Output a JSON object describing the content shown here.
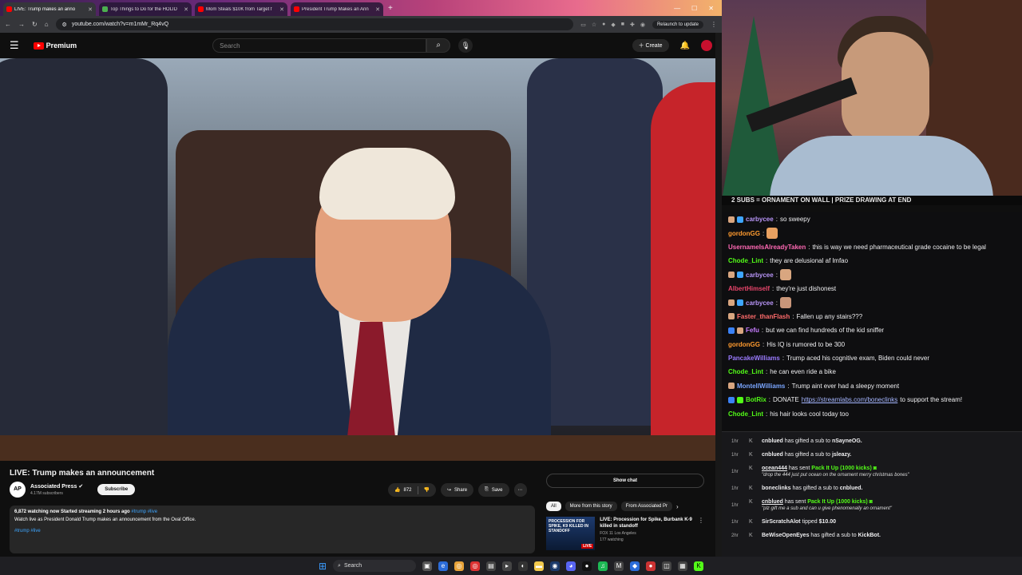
{
  "browser": {
    "tabs": [
      {
        "title": "LIVE: Trump makes an anno",
        "active": true
      },
      {
        "title": "Top Things to Do for the HOLID",
        "active": false
      },
      {
        "title": "Mom Steals $10K from Target f",
        "active": false
      },
      {
        "title": "President Trump Makes an Ann",
        "active": false
      }
    ],
    "url": "youtube.com/watch?v=m1mMr_Rq4vQ",
    "relaunch_label": "Relaunch to update"
  },
  "youtube": {
    "logo_text": "Premium",
    "search_placeholder": "Search",
    "create_label": "Create",
    "video_title": "LIVE: Trump makes an announcement",
    "channel_name": "Associated Press",
    "channel_logo": "AP",
    "subscribers": "4.17M subscribers",
    "subscribe_label": "Subscribe",
    "likes": "872",
    "share_label": "Share",
    "save_label": "Save",
    "description": {
      "meta": "6,872 watching now  Started streaming 2 hours ago",
      "meta_tags": "#trump #live",
      "text": "Watch live as President Donald Trump makes an announcement from the Oval Office.",
      "hashtags": "#trump #live"
    },
    "show_chat_label": "Show chat",
    "chips": [
      "All",
      "More from this story",
      "From Associated Pr"
    ],
    "recommendation": {
      "thumb_text": "PROCESSION FOR SPIKE, K9 KILLED IN STANDOFF",
      "thumb_badge": "LIVE",
      "title": "LIVE: Procession for Spike, Burbank K-9 killed in standoff",
      "channel": "FOX 11 Los Angeles",
      "watching": "177 watching"
    }
  },
  "stream": {
    "banner": "2 SUBS = ORNAMENT ON WALL | PRIZE DRAWING AT END"
  },
  "chat": [
    {
      "user": "carbycee",
      "text": "so sweepy",
      "color": "#b794f6"
    },
    {
      "user": "gordonGG",
      "text": "",
      "color": "#ff9b2f"
    },
    {
      "user": "UsernameIsAlreadyTaken",
      "text": "this is way we need pharmaceutical grade cocaine to be legal",
      "color": "#ff69b4"
    },
    {
      "user": "Chode_Lint",
      "text": "they are delusional af lmfao",
      "color": "#53fc18"
    },
    {
      "user": "carbycee",
      "text": "",
      "color": "#b794f6"
    },
    {
      "user": "AlbertHimself",
      "text": "they're just dishonest",
      "color": "#e8456b"
    },
    {
      "user": "carbycee",
      "text": "",
      "color": "#b794f6"
    },
    {
      "user": "Faster_thanFlash",
      "text": "Fallen up any stairs???",
      "color": "#ff6b6b"
    },
    {
      "user": "Fefu",
      "text": "but we can find hundreds of the kid sniffer",
      "color": "#c77dff"
    },
    {
      "user": "gordonGG",
      "text": "His IQ is rumored to be 300",
      "color": "#ff9b2f"
    },
    {
      "user": "PancakeWilliams",
      "text": "Trump aced his cognitive exam, Biden could never",
      "color": "#9b7bff"
    },
    {
      "user": "Chode_Lint",
      "text": "he can even ride a bike",
      "color": "#53fc18"
    },
    {
      "user": "MontellWilliams",
      "text": "Trump aint ever had a sleepy moment",
      "color": "#7aa6ff"
    },
    {
      "user": "BotRix",
      "text": "DONATE",
      "link": "https://streamlabs.com/boneclinks",
      "after": "to support the stream!",
      "color": "#53fc18"
    },
    {
      "user": "Chode_Lint",
      "text": "his hair looks cool today too",
      "color": "#53fc18"
    }
  ],
  "events": [
    {
      "time": "1hr",
      "who": "cnblued",
      "text": "has gifted a sub to",
      "target": "nSayneOG."
    },
    {
      "time": "1hr",
      "who": "cnblued",
      "text": "has gifted a sub to",
      "target": "jsleazy."
    },
    {
      "time": "1hr",
      "who": "ocean444",
      "text": "has sent",
      "target": "Pack It Up (1000 kicks)",
      "quote": "\"drop the 444 just put ocean on the ornament merry christmas bones\""
    },
    {
      "time": "1hr",
      "who": "boneclinks",
      "text": "has gifted a sub to",
      "target": "cnblued."
    },
    {
      "time": "1hr",
      "who": "cnblued",
      "text": "has sent",
      "target": "Pack It Up (1000 kicks)",
      "quote": "\"plz gift me a sub and can u give phenomenally an ornament\""
    },
    {
      "time": "1hr",
      "who": "SirScratchAlot",
      "text": "tipped",
      "target": "$10.00"
    },
    {
      "time": "2hr",
      "who": "BeWiseOpenEyes",
      "text": "has gifted a sub to",
      "target": "KickBot."
    }
  ],
  "taskbar": {
    "search_label": "Search"
  },
  "colors": {
    "youtube_red": "#ff0000",
    "kick_green": "#53fc18",
    "link": "#3ea6ff"
  }
}
